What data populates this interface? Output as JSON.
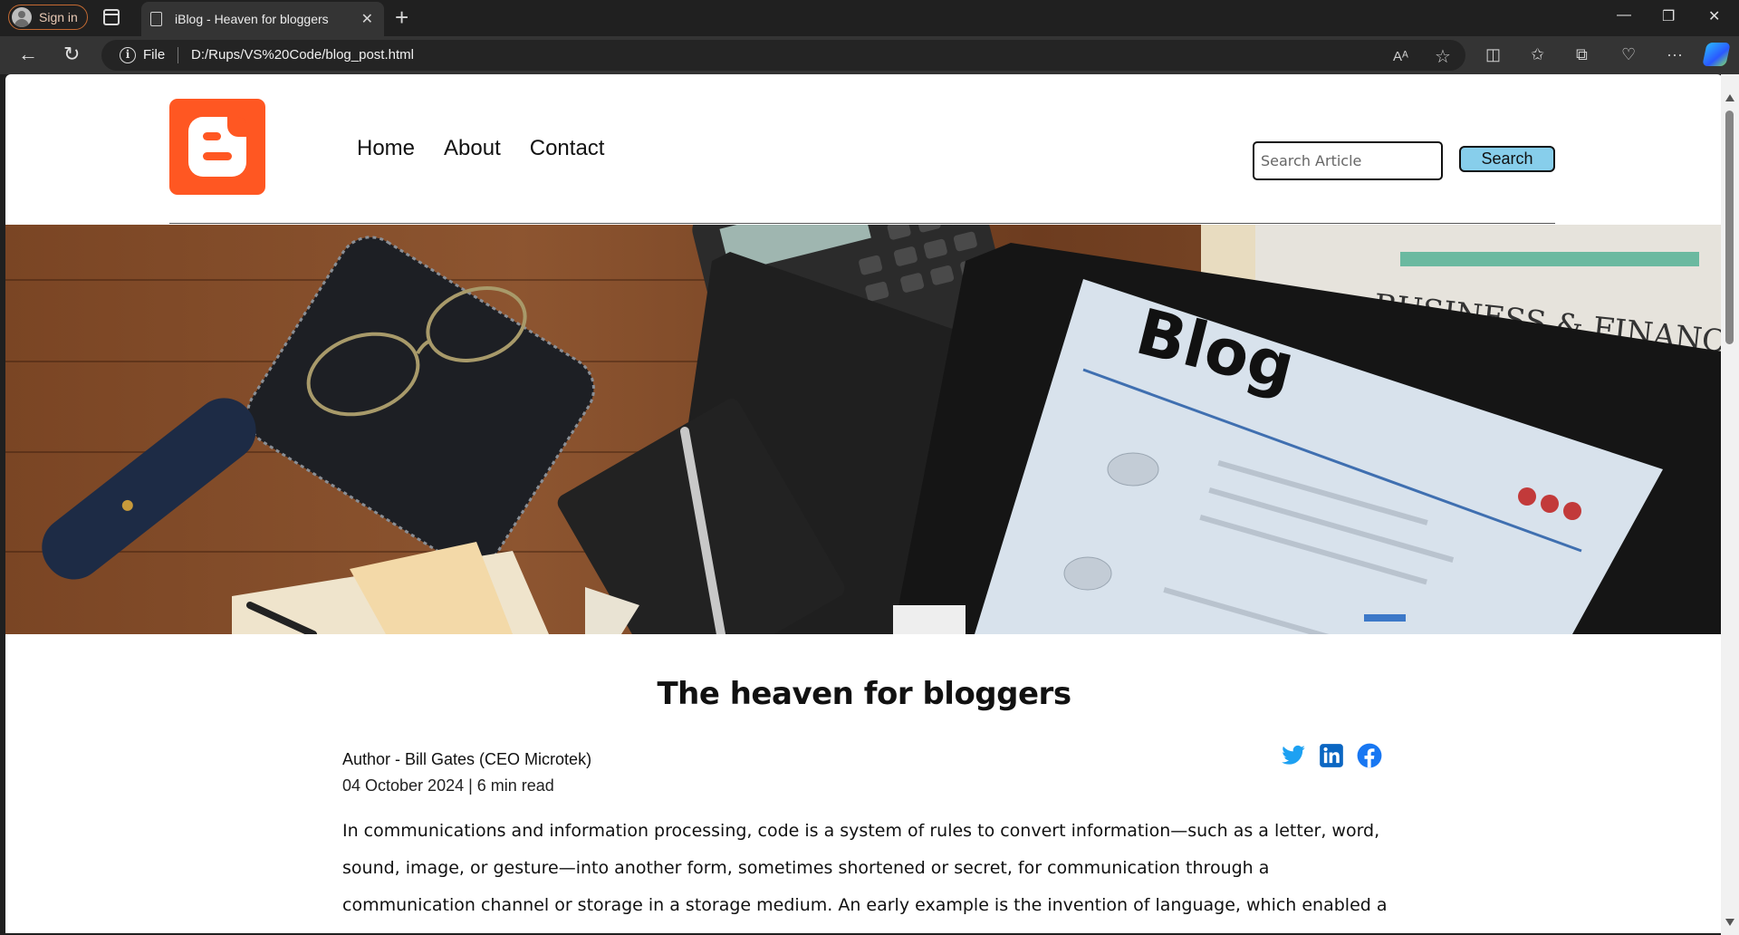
{
  "browser": {
    "signin_label": "Sign in",
    "tab_title": "iBlog - Heaven for bloggers",
    "url_scheme": "File",
    "url": "D:/Rups/VS%20Code/blog_post.html",
    "icons": [
      "back-icon",
      "refresh-icon",
      "info-icon",
      "read-aloud-icon",
      "favorite-star-icon",
      "split-screen-icon",
      "favorites-icon",
      "collections-icon",
      "browser-essentials-icon",
      "more-icon",
      "copilot-icon"
    ]
  },
  "site": {
    "logo_icon": "blogger-logo-icon",
    "nav": {
      "home": "Home",
      "about": "About",
      "contact": "Contact"
    },
    "search": {
      "placeholder": "Search Article",
      "button": "Search"
    }
  },
  "hero": {
    "newspaper_text": "BUSINESS & FINANCE",
    "screen_title": "Blog"
  },
  "article": {
    "title": "The heaven for bloggers",
    "author": "Author - Bill Gates (CEO Microtek)",
    "date_line": "04 October 2024 | 6 min read",
    "social": {
      "twitter": "twitter-icon",
      "linkedin": "linkedin-icon",
      "facebook": "facebook-icon"
    },
    "body": "In communications and information processing, code is a system of rules to convert information—such as a letter, word, sound, image, or gesture—into another form, sometimes shortened or secret, for communication through a communication channel or storage in a storage medium. An early example is the invention of language, which enabled a person, through speech, to"
  },
  "colors": {
    "brand": "#ff5722",
    "search_button": "#87ceeb",
    "twitter": "#1da1f2",
    "linkedin": "#0a66c2",
    "facebook": "#1877f2"
  }
}
